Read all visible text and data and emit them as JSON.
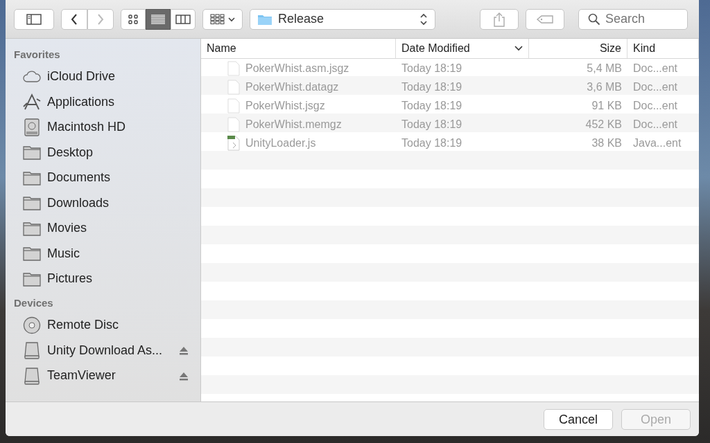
{
  "toolbar": {
    "nav": [
      {
        "kind": "back",
        "disabled": false
      },
      {
        "kind": "forward",
        "disabled": true
      }
    ],
    "view_modes": [
      {
        "kind": "icons",
        "selected": false
      },
      {
        "kind": "list",
        "selected": true
      },
      {
        "kind": "columns",
        "selected": false
      }
    ],
    "location": "Release",
    "search": {
      "placeholder": "Search"
    }
  },
  "sidebar": [
    {
      "heading": "Favorites",
      "items": [
        {
          "kind": "cloud",
          "label": "iCloud Drive",
          "eject": false
        },
        {
          "kind": "apps",
          "label": "Applications",
          "eject": false
        },
        {
          "kind": "hd",
          "label": "Macintosh HD",
          "eject": false
        },
        {
          "kind": "folder",
          "label": "Desktop",
          "eject": false
        },
        {
          "kind": "folder",
          "label": "Documents",
          "eject": false
        },
        {
          "kind": "folder",
          "label": "Downloads",
          "eject": false
        },
        {
          "kind": "folder",
          "label": "Movies",
          "eject": false
        },
        {
          "kind": "folder",
          "label": "Music",
          "eject": false
        },
        {
          "kind": "folder",
          "label": "Pictures",
          "eject": false
        }
      ]
    },
    {
      "heading": "Devices",
      "items": [
        {
          "kind": "disc",
          "label": "Remote Disc",
          "eject": false
        },
        {
          "kind": "drive",
          "label": "Unity Download As...",
          "eject": true
        },
        {
          "kind": "drive",
          "label": "TeamViewer",
          "eject": true
        }
      ]
    }
  ],
  "table": {
    "columns": [
      {
        "label": "Name",
        "sorted": false
      },
      {
        "label": "Date Modified",
        "sorted": true
      },
      {
        "label": "Size",
        "sorted": false
      },
      {
        "label": "Kind",
        "sorted": false
      }
    ],
    "rows": [
      {
        "kind": "doc",
        "name": "PokerWhist.asm.jsgz",
        "date": "Today 18:19",
        "size": "5,4 MB",
        "type": "Doc...ent",
        "disabled": true
      },
      {
        "kind": "doc",
        "name": "PokerWhist.datagz",
        "date": "Today 18:19",
        "size": "3,6 MB",
        "type": "Doc...ent",
        "disabled": true
      },
      {
        "kind": "doc",
        "name": "PokerWhist.jsgz",
        "date": "Today 18:19",
        "size": "91 KB",
        "type": "Doc...ent",
        "disabled": true
      },
      {
        "kind": "doc",
        "name": "PokerWhist.memgz",
        "date": "Today 18:19",
        "size": "452 KB",
        "type": "Doc...ent",
        "disabled": true
      },
      {
        "kind": "script",
        "name": "UnityLoader.js",
        "date": "Today 18:19",
        "size": "38 KB",
        "type": "Java...ent",
        "disabled": true
      }
    ]
  },
  "buttons": [
    {
      "label": "Cancel",
      "disabled": false
    },
    {
      "label": "Open",
      "disabled": true
    }
  ]
}
